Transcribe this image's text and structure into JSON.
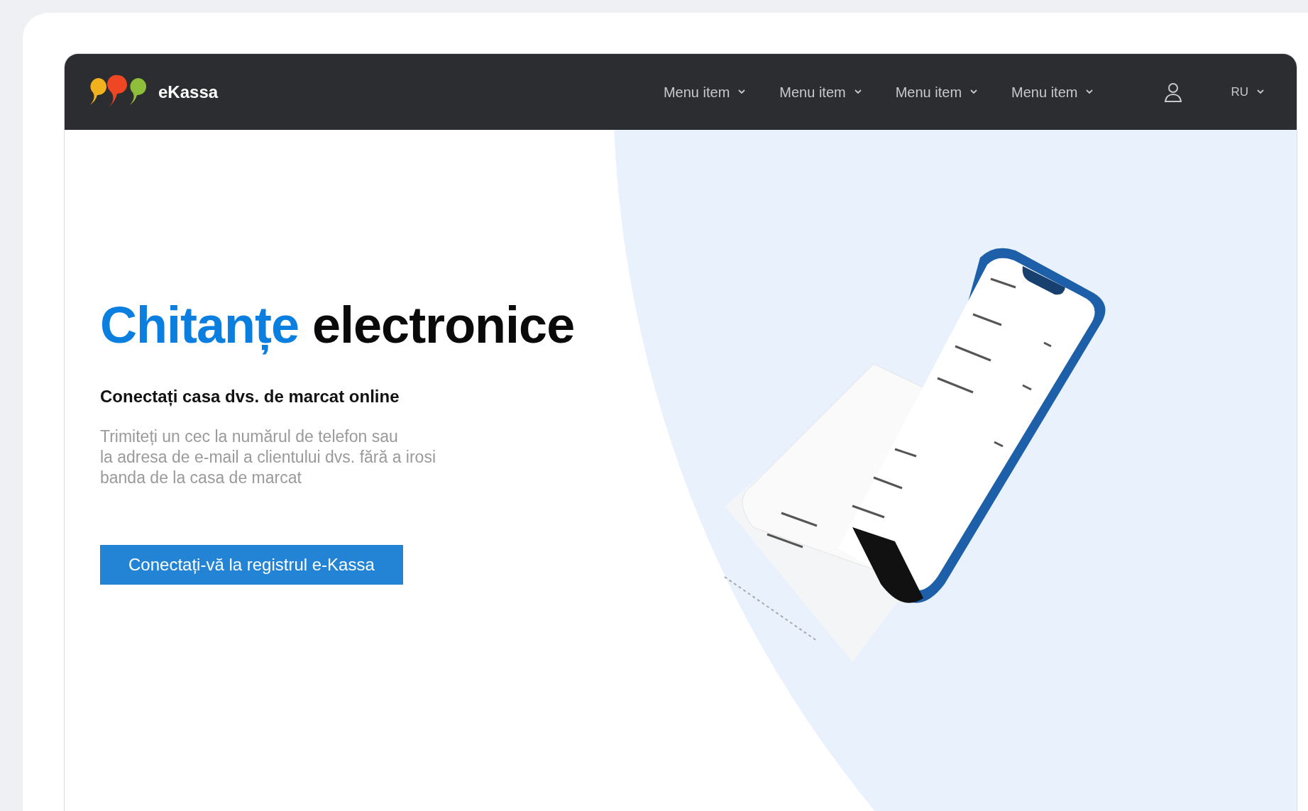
{
  "brand": {
    "name": "eKassa"
  },
  "nav": {
    "items": [
      {
        "label": "Menu item"
      },
      {
        "label": "Menu item"
      },
      {
        "label": "Menu item"
      },
      {
        "label": "Menu item"
      }
    ],
    "language": "RU"
  },
  "hero": {
    "title_accent": "Chitanțe",
    "title_rest": "electronice",
    "subtitle": "Conectați casa dvs. de marcat online",
    "description": "Trimiteți un cec la numărul de telefon sau\nla adresa de e-mail a clientului dvs. fără a irosi\nbanda de la casa de marcat",
    "button": "Conectați-vă la registrul e-Kassa"
  }
}
